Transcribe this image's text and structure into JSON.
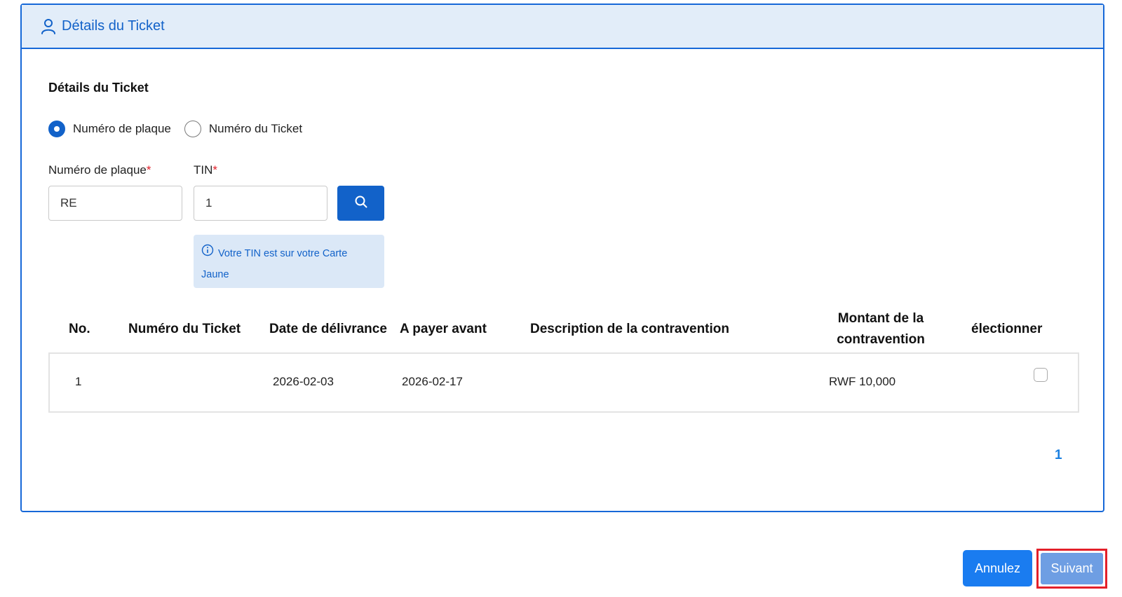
{
  "header": {
    "title": "Détails du Ticket",
    "icon": "user-icon"
  },
  "section": {
    "title": "Détails du Ticket"
  },
  "search_mode": {
    "options": [
      {
        "label": "Numéro de plaque",
        "selected": true
      },
      {
        "label": "Numéro du Ticket",
        "selected": false
      }
    ]
  },
  "fields": {
    "plate": {
      "label": "Numéro de plaque",
      "required_mark": "*",
      "value": "RE"
    },
    "tin": {
      "label": "TIN",
      "required_mark": "*",
      "value": "1"
    }
  },
  "info": {
    "text_line1": "Votre TIN est sur votre Carte",
    "text_line2": "Jaune",
    "icon": "info-icon"
  },
  "table": {
    "columns": [
      "No.",
      "Numéro du Ticket",
      "Date de délivrance",
      "A payer avant",
      "Description de la contravention",
      "Montant de la contravention",
      "électionner"
    ],
    "rows": [
      {
        "no": "1",
        "ticket_number": "",
        "issue_date": "2026-02-03",
        "due_date": "2026-02-17",
        "description": "",
        "amount": "RWF 10,000",
        "selected": false
      }
    ]
  },
  "pagination": {
    "current_page": "1"
  },
  "actions": {
    "cancel_label": "Annulez",
    "next_label": "Suivant"
  },
  "colors": {
    "accent": "#1262c9",
    "header_bg": "#e2edf9",
    "highlight": "#e3202a"
  }
}
